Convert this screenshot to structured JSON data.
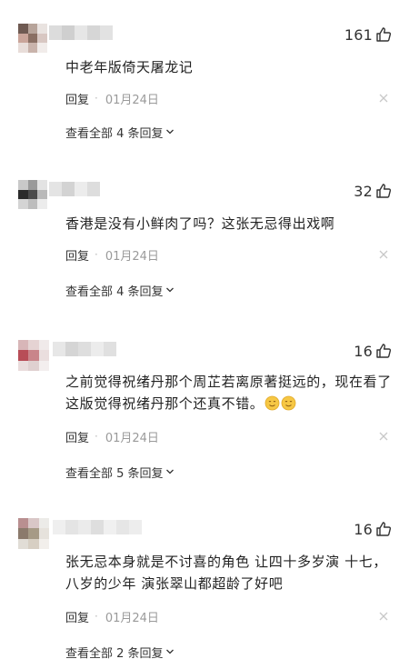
{
  "comments": [
    {
      "likes": "161",
      "text": "中老年版倚天屠龙记",
      "reply_label": "回复",
      "date": "01月24日",
      "view_all": "查看全部 4 条回复"
    },
    {
      "likes": "32",
      "text": "香港是没有小鲜肉了吗？这张无忌得出戏啊",
      "reply_label": "回复",
      "date": "01月24日",
      "view_all": "查看全部 4 条回复"
    },
    {
      "likes": "16",
      "text": "之前觉得祝绪丹那个周芷若离原著挺远的，现在看了这版觉得祝绪丹那个还真不错。",
      "emojis": [
        "slightly-smiling-face",
        "slightly-smiling-face"
      ],
      "reply_label": "回复",
      "date": "01月24日",
      "view_all": "查看全部 5 条回复"
    },
    {
      "likes": "16",
      "text": "张无忌本身就是不讨喜的角色 让四十多岁演 十七，八岁的少年 演张翠山都超龄了好吧",
      "reply_label": "回复",
      "date": "01月24日",
      "view_all": "查看全部 2 条回复"
    }
  ],
  "colors": {
    "text": "#222222",
    "muted": "#9a9a9a",
    "icon": "#333333",
    "close": "#c8c8c8",
    "emoji": "#f6c744"
  }
}
